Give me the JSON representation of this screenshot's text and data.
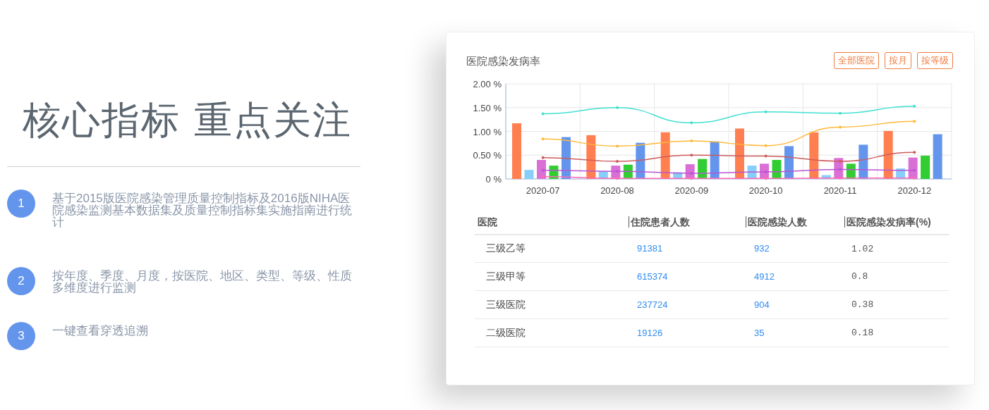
{
  "headline": "核心指标 重点关注",
  "features": [
    {
      "number": "1",
      "text": "基于2015版医院感染管理质量控制指标及2016版NIHA医院感染监测基本数据集及质量控制指标集实施指南进行统计"
    },
    {
      "number": "2",
      "text": "按年度、季度、月度，按医院、地区、类型、等级、性质多维度进行监测"
    },
    {
      "number": "3",
      "text": "一键查看穿透追溯"
    }
  ],
  "card": {
    "title": "医院感染发病率",
    "filters": [
      "全部医院",
      "按月",
      "按等级"
    ],
    "chart_data": {
      "type": "bar",
      "categories": [
        "2020-07",
        "2020-08",
        "2020-09",
        "2020-10",
        "2020-11",
        "2020-12"
      ],
      "ylim": [
        0,
        2
      ],
      "grid": true,
      "yticks": [
        {
          "value": 0,
          "label": "0 %"
        },
        {
          "value": 0.5,
          "label": "0.50 %"
        },
        {
          "value": 1,
          "label": "1.00 %"
        },
        {
          "value": 1.5,
          "label": "1.50 %"
        },
        {
          "value": 2,
          "label": "2.00 %"
        }
      ],
      "series": [
        {
          "color": "#ff7f50",
          "values": [
            1.17,
            0.92,
            0.98,
            1.06,
            0.98,
            1.01
          ]
        },
        {
          "color": "#87cefa",
          "values": [
            0.19,
            0.16,
            0.14,
            0.28,
            0.08,
            0.22
          ]
        },
        {
          "color": "#da70d6",
          "values": [
            0.4,
            0.28,
            0.31,
            0.32,
            0.44,
            0.45
          ]
        },
        {
          "color": "#32cd32",
          "values": [
            0.28,
            0.3,
            0.42,
            0.4,
            0.32,
            0.49
          ]
        },
        {
          "color": "#6495ed",
          "values": [
            0.88,
            0.76,
            0.79,
            0.69,
            0.72,
            0.94
          ]
        },
        {
          "type": "line",
          "color": "#40e0d0",
          "values": [
            1.37,
            1.5,
            1.18,
            1.41,
            1.38,
            1.53
          ]
        },
        {
          "type": "line",
          "color": "#ffb938",
          "values": [
            0.84,
            0.69,
            0.8,
            0.7,
            1.09,
            1.21
          ]
        },
        {
          "type": "line",
          "color": "#cd5c5c",
          "values": [
            0.45,
            0.37,
            0.5,
            0.48,
            0.37,
            0.56
          ]
        },
        {
          "type": "line",
          "color": "#ba55d3",
          "values": [
            0.18,
            0.16,
            0.12,
            0.15,
            0.2,
            0.18
          ]
        },
        {
          "type": "line",
          "color": "#ff69b4",
          "values": [
            0.05,
            0.01,
            0.01,
            0.01,
            0.02,
            0.02
          ]
        }
      ]
    },
    "table": {
      "columns": [
        "医院",
        "住院患者人数",
        "医院感染人数",
        "医院感染发病率(%)"
      ],
      "rows": [
        [
          "三级乙等",
          "91381",
          "932",
          "1.02"
        ],
        [
          "三级甲等",
          "615374",
          "4912",
          "0.8"
        ],
        [
          "三级医院",
          "237724",
          "904",
          "0.38"
        ],
        [
          "二级医院",
          "19126",
          "35",
          "0.18"
        ]
      ]
    }
  }
}
